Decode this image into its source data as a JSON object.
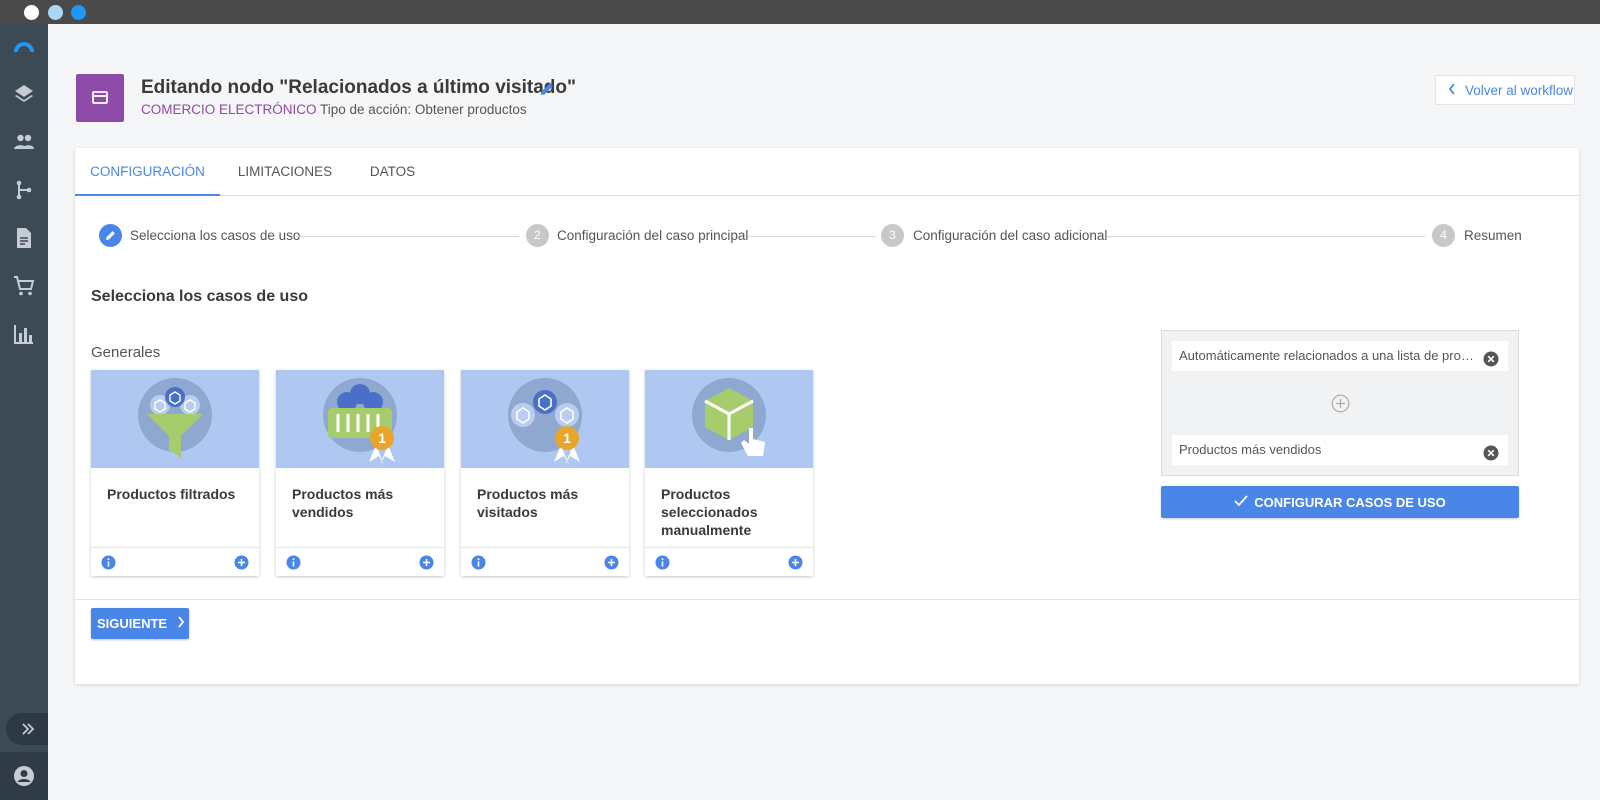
{
  "window": {
    "dots": [
      "#ffffff",
      "#a8d8f5",
      "#2196f3"
    ]
  },
  "sidebar": {
    "icons": [
      "logo-icon",
      "layers-icon",
      "people-icon",
      "workflow-icon",
      "document-icon",
      "cart-icon",
      "bar-chart-icon"
    ],
    "expand_icon": "double-chevron-right-icon",
    "user_icon": "account-circle-icon"
  },
  "header": {
    "title": "Editando nodo \"Relacionados a último visitado\"",
    "category": "COMERCIO ELECTRÓNICO",
    "action_type": "Tipo de acción: Obtener productos",
    "back_label": "Volver al workflow"
  },
  "tabs": [
    {
      "label": "CONFIGURACIÓN",
      "active": true
    },
    {
      "label": "LIMITACIONES",
      "active": false
    },
    {
      "label": "DATOS",
      "active": false
    }
  ],
  "steps": [
    {
      "number": "",
      "label": "Selecciona los casos de uso",
      "done": true
    },
    {
      "number": "2",
      "label": "Configuración del caso principal",
      "done": false
    },
    {
      "number": "3",
      "label": "Configuración del caso adicional",
      "done": false
    },
    {
      "number": "4",
      "label": "Resumen",
      "done": false
    }
  ],
  "section_title": "Selecciona los casos de uso",
  "group_label": "Generales",
  "use_cases": [
    {
      "title": "Productos filtrados",
      "icon": "funnel-products-icon"
    },
    {
      "title": "Productos más vendidos",
      "icon": "basket-medal-icon"
    },
    {
      "title": "Productos más visitados",
      "icon": "products-medal-icon"
    },
    {
      "title": "Productos seleccionados manualmente",
      "icon": "box-hand-icon"
    }
  ],
  "selected": {
    "items": [
      "Automáticamente relacionados a una lista de productos",
      "Productos más vendidos"
    ]
  },
  "configure_button": "CONFIGURAR CASOS DE USO",
  "next_button": "SIGUIENTE",
  "colors": {
    "accent": "#4a86e8",
    "category": "#8e4aa8",
    "sidebar": "#3c4a56",
    "card_image_bg": "#aec8f2"
  }
}
